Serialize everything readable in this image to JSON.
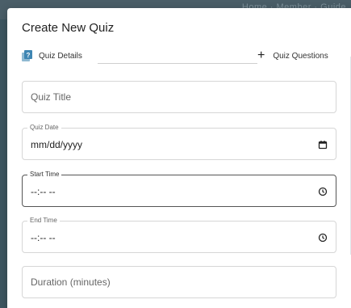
{
  "background": {
    "header_text": "Home  ·  Member  ·  Guide"
  },
  "dialog": {
    "title": "Create New Quiz",
    "stepper": {
      "steps": [
        {
          "label": "Quiz Details",
          "icon": "quiz-question-icon",
          "active": true
        },
        {
          "label": "Quiz Questions",
          "icon": "plus-icon",
          "active": false
        }
      ]
    },
    "fields": {
      "quiz_title": {
        "placeholder": "Quiz Title"
      },
      "quiz_date": {
        "label": "Quiz Date",
        "value": "mm/dd/yyyy",
        "icon": "calendar-icon"
      },
      "start_time": {
        "label": "Start Time",
        "value": "--:-- --",
        "icon": "clock-icon",
        "focused": true
      },
      "end_time": {
        "label": "End Time",
        "value": "--:-- --",
        "icon": "clock-icon"
      },
      "duration": {
        "placeholder": "Duration (minutes)"
      }
    }
  },
  "colors": {
    "accent_icon": "#4a8fb5",
    "focus_border": "#555555",
    "field_border": "#d6d6d6"
  }
}
